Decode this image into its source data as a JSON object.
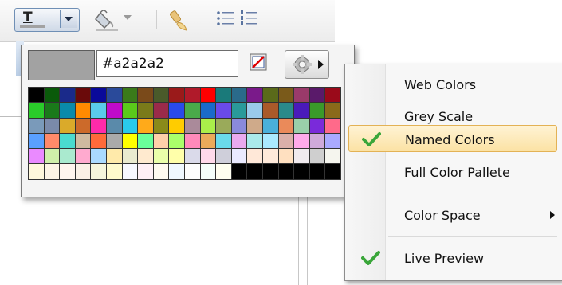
{
  "toolbar": {
    "items": [
      {
        "name": "text-color",
        "icon": "text-color-icon",
        "glyph": "T"
      },
      {
        "name": "fill-color",
        "icon": "paint-bucket-icon"
      },
      {
        "name": "clear-format",
        "icon": "brush-icon"
      },
      {
        "name": "bullet-list",
        "icon": "bullet-list-icon"
      },
      {
        "name": "numbered-list",
        "icon": "numbered-list-icon"
      }
    ]
  },
  "picker": {
    "current_color": "#a2a2a2",
    "hex_value": "#a2a2a2",
    "no_color_icon": "no-color-icon",
    "settings_icon": "gear-icon",
    "swatches": [
      "#000000",
      "#0a5a0a",
      "#1a2a8a",
      "#6a0a0a",
      "#0a0a9a",
      "#2a4a9a",
      "#3a7a1a",
      "#7a4a1a",
      "#4a5a2a",
      "#9a1a1a",
      "#b01a2a",
      "#ff0000",
      "#1a7a7a",
      "#2a6a8a",
      "#7a1a8a",
      "#5a6a1a",
      "#7a5a1a",
      "#9a3a6a",
      "#5a1a6a",
      "#9a0a1a",
      "#2acc2a",
      "#1a7a1a",
      "#0a8aaa",
      "#ff8a00",
      "#5acaea",
      "#c00aca",
      "#5aca1a",
      "#7a7a1a",
      "#9a2a4a",
      "#2a4aea",
      "#4aaa4a",
      "#1a6aca",
      "#6a4aea",
      "#2a9a9a",
      "#9acaea",
      "#aa5a2a",
      "#2a8a8a",
      "#4a1aba",
      "#3a9a2a",
      "#8a6a1a",
      "#7a9aba",
      "#7a8aaa",
      "#daaa2a",
      "#cc6a2a",
      "#ff2aaa",
      "#5a8aaa",
      "#2acaea",
      "#ffaa1a",
      "#8a8a1a",
      "#ffcc00",
      "#aa8a9a",
      "#aaee4a",
      "#9aaa5a",
      "#8a8adb",
      "#cfaa8a",
      "#4ab0da",
      "#ea8a5a",
      "#9acfaa",
      "#7a2ada",
      "#ff6a8a",
      "#5aa0ff",
      "#ff8a6a",
      "#4adacf",
      "#cfbaa0",
      "#ff6a3a",
      "#aaaaaa",
      "#ffff00",
      "#6aff9a",
      "#ffcfaa",
      "#aaff6a",
      "#ff8aba",
      "#eaaa5a",
      "#6adaea",
      "#eaaaee",
      "#aaeaea",
      "#aaeaff",
      "#dab0aa",
      "#ffaaea",
      "#cfaada",
      "#aaaaff",
      "#ea8aff",
      "#cff0aa",
      "#aaeacf",
      "#ffaacf",
      "#aadaff",
      "#ffeaaa",
      "#eaeacf",
      "#ffeacf",
      "#eaffaa",
      "#ffffaa",
      "#dadaea",
      "#ffdaea",
      "#cfcfda",
      "#eaeaff",
      "#ffe8d8",
      "#ffeada",
      "#ffe0c0",
      "#f0eaee",
      "#cfcfcf",
      "#f5f5ee",
      "#fff8dc",
      "#fdf5e6",
      "#fff5ee",
      "#faf0e6",
      "#f5f5dc",
      "#fffacd",
      "#f8f8ff",
      "#fff0f5",
      "#fffaf0",
      "#f0f8ff",
      "#fdfdfd",
      "#f5fffa",
      "#fffff0",
      "#000000",
      "#000000",
      "#000000",
      "#000000",
      "#000000",
      "#000000",
      "#000000"
    ]
  },
  "menu": {
    "items": [
      {
        "label": "Web Colors",
        "checked": false
      },
      {
        "label": "Grey Scale",
        "checked": false
      },
      {
        "label": "Named Colors",
        "checked": true,
        "highlighted": true
      },
      {
        "label": "Full Color Pallete",
        "checked": false
      },
      {
        "label": "Color Space",
        "checked": false,
        "submenu": true
      },
      {
        "label": "Live Preview",
        "checked": true
      }
    ]
  },
  "colors": {
    "accent_highlight": "#fbe2a4",
    "check_green": "#3aa63a"
  }
}
